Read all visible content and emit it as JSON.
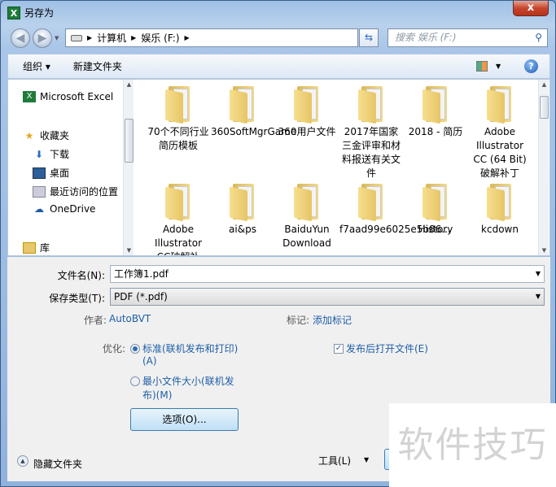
{
  "window": {
    "title": "另存为",
    "close": "x"
  },
  "nav": {
    "breadcrumb": [
      "计算机",
      "娱乐 (F:)"
    ],
    "search_placeholder": "搜索 娱乐 (F:)"
  },
  "toolbar": {
    "organize": "组织 ▾",
    "new_folder": "新建文件夹"
  },
  "sidebar": {
    "items": [
      {
        "label": "Microsoft Excel",
        "icon": "excel-icon"
      },
      {
        "label": "收藏夹",
        "icon": "star-icon"
      },
      {
        "label": "下载",
        "icon": "download-icon"
      },
      {
        "label": "桌面",
        "icon": "desktop-icon"
      },
      {
        "label": "最近访问的位置",
        "icon": "recent-icon"
      },
      {
        "label": "OneDrive",
        "icon": "cloud-icon"
      },
      {
        "label": "库",
        "icon": "library-icon"
      }
    ]
  },
  "files": [
    {
      "name": "70个不同行业简历模板"
    },
    {
      "name": "360SoftMgrGame"
    },
    {
      "name": "360用户文件"
    },
    {
      "name": "2017年国家三金评审和材料报送有关文件"
    },
    {
      "name": "2018 - 简历"
    },
    {
      "name": "Adobe Illustrator CC (64 Bit) 破解补丁"
    },
    {
      "name": "Adobe Illustrator CC破解补"
    },
    {
      "name": "ai&ps"
    },
    {
      "name": "BaiduYun Download"
    },
    {
      "name": "f7aad99e6025e5b86..."
    },
    {
      "name": "History"
    },
    {
      "name": "kcdown"
    }
  ],
  "form": {
    "filename_label": "文件名(N):",
    "filename_value": "工作簿1.pdf",
    "filetype_label": "保存类型(T):",
    "filetype_value": "PDF (*.pdf)",
    "author_label": "作者:",
    "author_value": "AutoBVT",
    "tags_label": "标记:",
    "tags_value": "添加标记",
    "optimize_label": "优化:",
    "opt_standard": "标准(联机发布和打印)",
    "opt_standard_key": "(A)",
    "opt_min": "最小文件大小(联机发",
    "opt_min_key": "布)(M)",
    "open_after": "发布后打开文件(E)",
    "open_after_checked": true,
    "options_button": "选项(O)...",
    "hide_folders": "隐藏文件夹",
    "tools": "工具(L)"
  },
  "watermark": "软件技巧"
}
